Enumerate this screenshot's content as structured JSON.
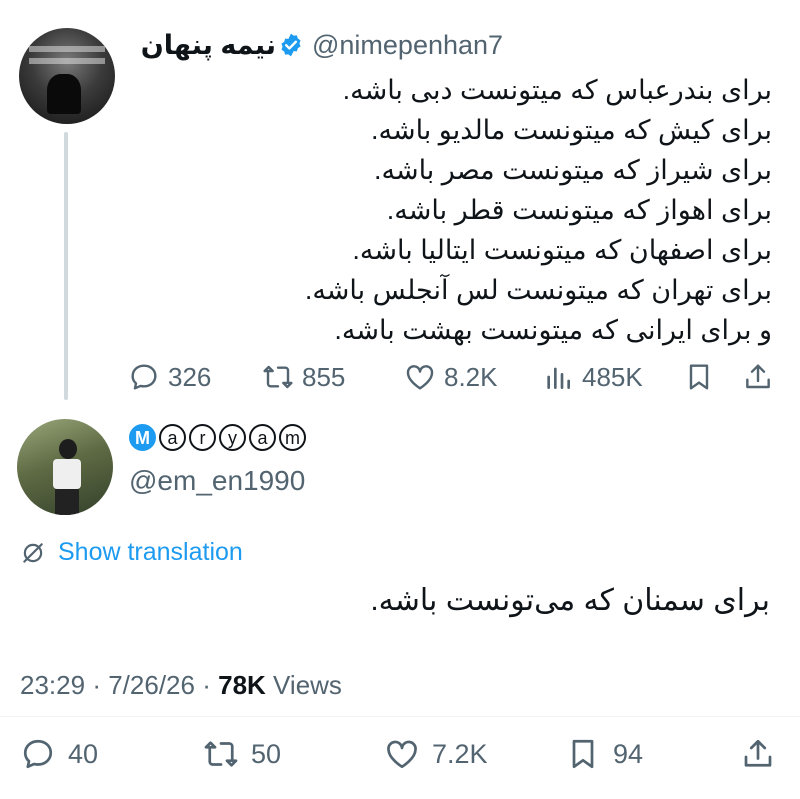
{
  "parent_tweet": {
    "author_name": "نیمه پنهان",
    "verified": true,
    "handle": "@nimepenhan7",
    "lines": [
      "برای بندرعباس که میتونست دبی باشه.",
      "برای کیش که میتونست مالدیو باشه.",
      "برای شیراز که میتونست مصر باشه.",
      "برای اهواز که میتونست قطر باشه.",
      "برای اصفهان که میتونست ایتالیا باشه.",
      "برای تهران که میتونست لس آنجلس باشه.",
      "و برای ایرانی که میتونست بهشت باشه."
    ],
    "stats": {
      "replies": "326",
      "reposts": "855",
      "likes": "8.2K",
      "views": "485K"
    }
  },
  "reply_tweet": {
    "display_name_letters": [
      "M",
      "a",
      "r",
      "y",
      "a",
      "m"
    ],
    "handle": "@em_en1990",
    "show_translation": "Show translation",
    "text": "برای سمنان که می‌تونست باشه.",
    "time": "23:29",
    "date": "7/26/26",
    "views_count": "78K",
    "views_label": "Views",
    "stats": {
      "replies": "40",
      "reposts": "50",
      "likes": "7.2K",
      "bookmarks": "94"
    }
  },
  "colors": {
    "accent": "#1d9bf0",
    "secondary_text": "#536471",
    "primary_text": "#0f1419"
  }
}
